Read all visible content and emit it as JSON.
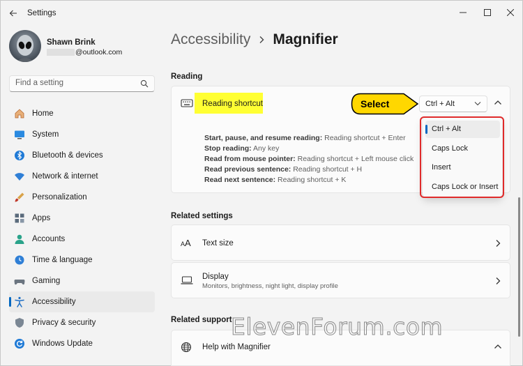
{
  "titlebar": {
    "app_title": "Settings"
  },
  "profile": {
    "name": "Shawn Brink",
    "email": "@outlook.com"
  },
  "search": {
    "placeholder": "Find a setting"
  },
  "sidebar": {
    "items": [
      {
        "label": "Home",
        "icon": "home-icon"
      },
      {
        "label": "System",
        "icon": "monitor-icon"
      },
      {
        "label": "Bluetooth & devices",
        "icon": "bluetooth-icon"
      },
      {
        "label": "Network & internet",
        "icon": "wifi-icon"
      },
      {
        "label": "Personalization",
        "icon": "brush-icon"
      },
      {
        "label": "Apps",
        "icon": "apps-icon"
      },
      {
        "label": "Accounts",
        "icon": "person-icon"
      },
      {
        "label": "Time & language",
        "icon": "globe-clock-icon"
      },
      {
        "label": "Gaming",
        "icon": "gamepad-icon"
      },
      {
        "label": "Accessibility",
        "icon": "accessibility-icon",
        "active": true
      },
      {
        "label": "Privacy & security",
        "icon": "shield-icon"
      },
      {
        "label": "Windows Update",
        "icon": "update-icon"
      }
    ]
  },
  "breadcrumb": {
    "parent": "Accessibility",
    "current": "Magnifier"
  },
  "reading": {
    "section_title": "Reading",
    "shortcut_label": "Reading shortcut",
    "dropdown_value": "Ctrl + Alt",
    "details": [
      {
        "term": "Start, pause, and resume reading:",
        "desc": " Reading shortcut + Enter"
      },
      {
        "term": "Stop reading:",
        "desc": " Any key"
      },
      {
        "term": "Read from mouse pointer:",
        "desc": " Reading shortcut + Left mouse click"
      },
      {
        "term": "Read previous sentence:",
        "desc": " Reading shortcut + H"
      },
      {
        "term": "Read next sentence:",
        "desc": " Reading shortcut + K"
      }
    ]
  },
  "callout": {
    "text": "Select"
  },
  "menu": {
    "options": [
      "Ctrl + Alt",
      "Caps Lock",
      "Insert",
      "Caps Lock or Insert"
    ],
    "selected": "Ctrl + Alt"
  },
  "related_settings": {
    "section_title": "Related settings",
    "text_size": "Text size",
    "display": "Display",
    "display_sub": "Monitors, brightness, night light, display profile"
  },
  "related_support": {
    "section_title": "Related support",
    "help": "Help with Magnifier"
  },
  "watermark": "ElevenForum.com",
  "colors": {
    "accent": "#0067c0",
    "highlight": "#ffff33",
    "callout": "#ffd700",
    "outline": "#e02a2a"
  }
}
